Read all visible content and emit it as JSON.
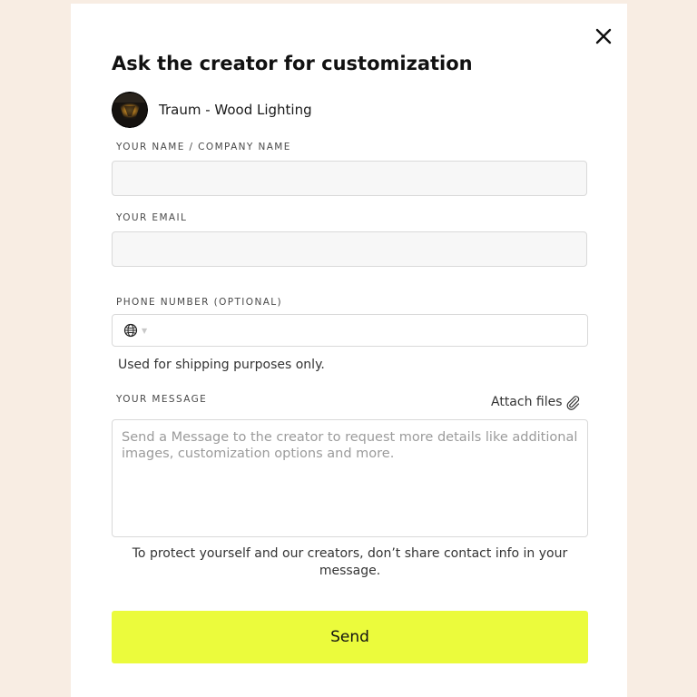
{
  "modal": {
    "title": "Ask the creator for customization",
    "close_icon": "close-icon"
  },
  "creator": {
    "name": "Traum - Wood Lighting",
    "avatar_icon": "creator-avatar"
  },
  "form": {
    "name_label": "YOUR NAME / COMPANY NAME",
    "name_value": "",
    "email_label": "YOUR EMAIL",
    "email_value": "",
    "phone_label": "PHONE NUMBER (OPTIONAL)",
    "phone_country_icon": "globe-icon",
    "phone_value": "",
    "phone_helper": "Used for shipping purposes only.",
    "message_label": "YOUR MESSAGE",
    "attach_label": "Attach files",
    "attach_icon": "paperclip-icon",
    "message_placeholder": "Send a Message to the creator to request more details like additional images, customization options and more.",
    "message_value": "",
    "notice": "To protect yourself and our creators, don’t share contact info in your message.",
    "send_label": "Send"
  },
  "colors": {
    "page_background": "#f8ede3",
    "modal_background": "#ffffff",
    "send_button": "#ebfb3c",
    "input_background": "#f7f7f7",
    "input_border": "#d9d9d9"
  }
}
